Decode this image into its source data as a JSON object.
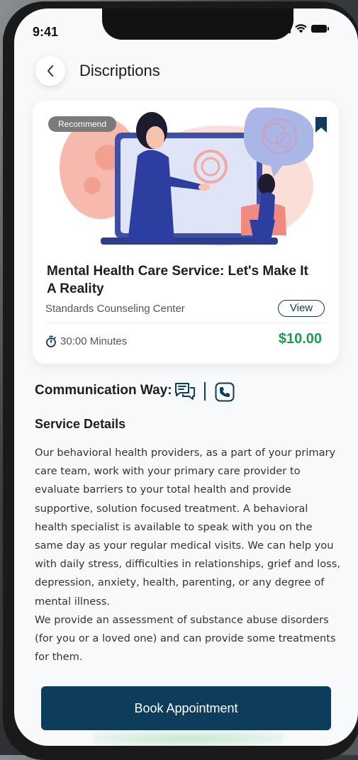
{
  "status_bar": {
    "time": "9:41"
  },
  "header": {
    "title": "Discriptions",
    "back_icon": "chevron-left-icon"
  },
  "card": {
    "badge": "Recommend",
    "title": "Mental Health Care Service: Let's Make It A Reality",
    "provider": "Standards Counseling Center",
    "view_label": "View",
    "duration": "30:00 Minutes",
    "price": "$10.00",
    "price_color": "#1a9d4a",
    "bookmarked": true
  },
  "communication": {
    "label": "Communication Way:",
    "icons": [
      "chat-icon",
      "phone-icon"
    ]
  },
  "service_details": {
    "title": "Service Details",
    "body": "Our behavioral health providers, as a part of your primary care team, work with your primary care provider to evaluate barriers to your total health and provide supportive, solution focused treatment. A behavioral health specialist is available to speak with you on the same day as your regular medical visits. We can help you with daily stress, difficulties in relationships, grief and loss, depression, anxiety, health, parenting, or any degree of mental illness.\nWe provide an assessment of substance abuse disorders (for you or a loved one) and can provide some treatments for them."
  },
  "primary_action": {
    "label": "Book Appointment"
  },
  "colors": {
    "primary": "#0d3c5c",
    "price": "#1a9d4a",
    "background": "#f8f9fb"
  }
}
